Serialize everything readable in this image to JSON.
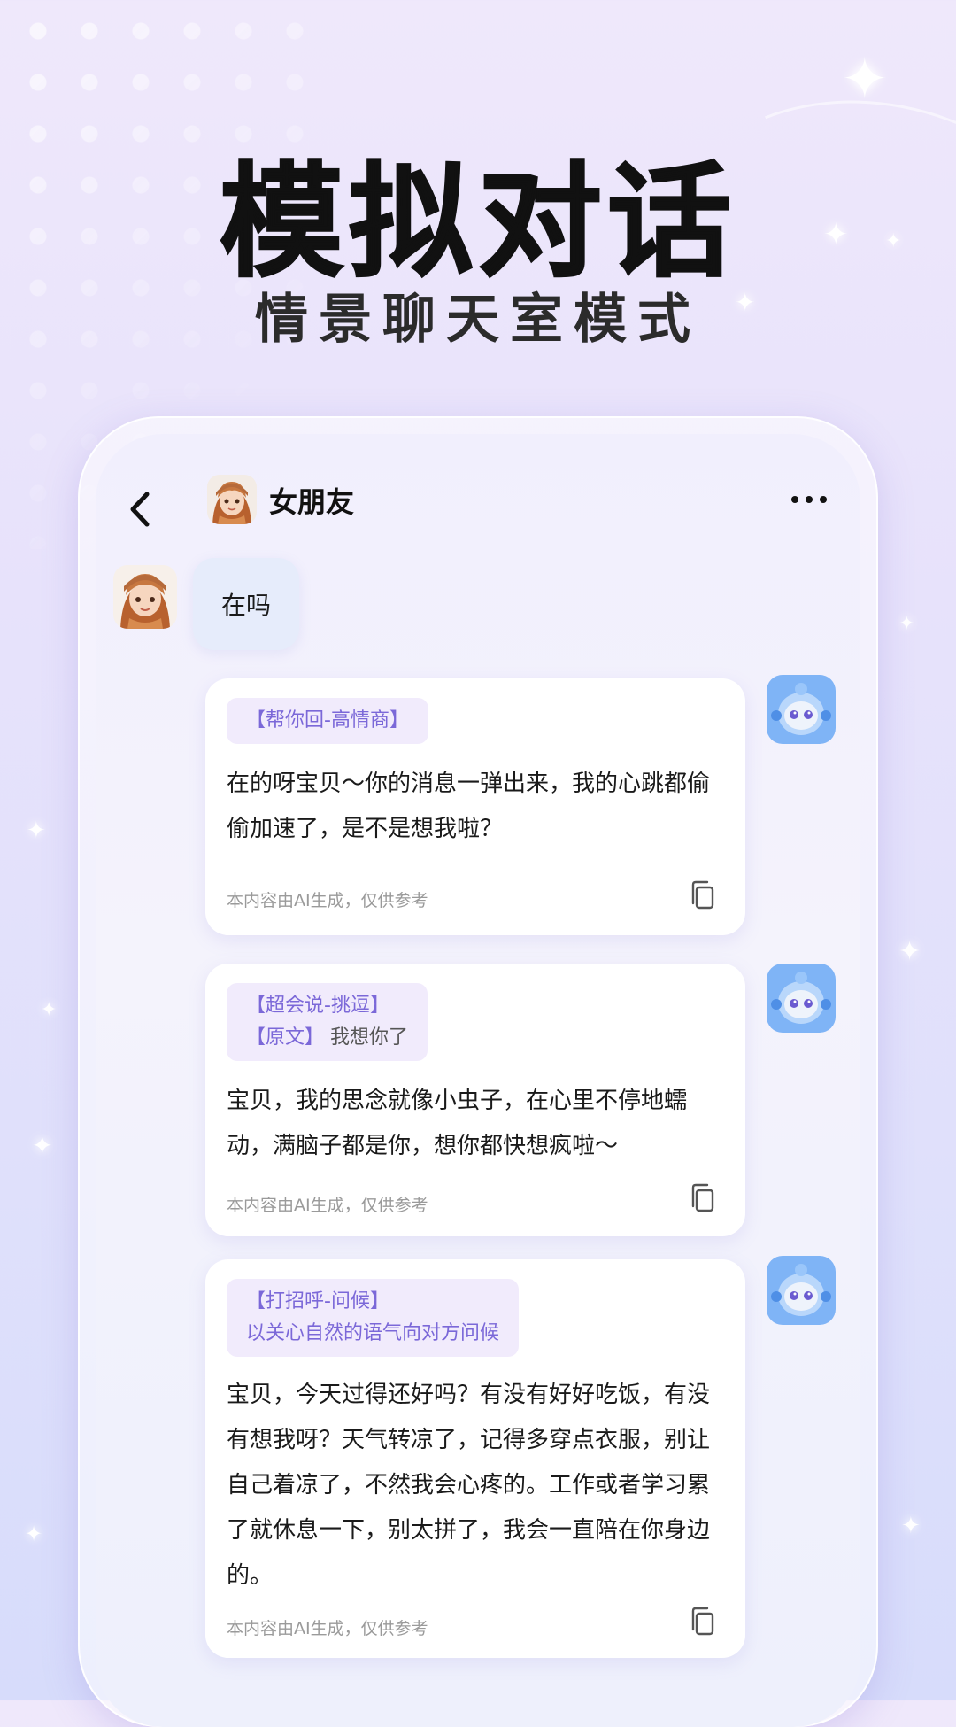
{
  "hero": {
    "title": "模拟对话",
    "subtitle": "情景聊天室模式"
  },
  "chat": {
    "contact_name": "女朋友",
    "incoming_message": "在吗",
    "replies": [
      {
        "tag_line1": "【帮你回-高情商】",
        "text": "在的呀宝贝～你的消息一弹出来，我的心跳都偷偷加速了，是不是想我啦？",
        "disclaimer": "本内容由AI生成，仅供参考"
      },
      {
        "tag_line1": "【超会说-挑逗】",
        "tag_line2_label": "【原文】",
        "tag_line2_value": "我想你了",
        "text": "宝贝，我的思念就像小虫子，在心里不停地蠕动，满脑子都是你，想你都快想疯啦～",
        "disclaimer": "本内容由AI生成，仅供参考"
      },
      {
        "tag_line1": "【打招呼-问候】",
        "tag_line2_value": "以关心自然的语气向对方问候",
        "text": "宝贝，今天过得还好吗？有没有好好吃饭，有没有想我呀？天气转凉了，记得多穿点衣服，别让自己着凉了，不然我会心疼的。工作或者学习累了就休息一下，别太拼了，我会一直陪在你身边的。",
        "disclaimer": "本内容由AI生成，仅供参考"
      }
    ]
  },
  "colors": {
    "accent_tag": "#7b68d8",
    "bubble_in": "#e6ecfb",
    "card_bg": "#ffffff"
  }
}
